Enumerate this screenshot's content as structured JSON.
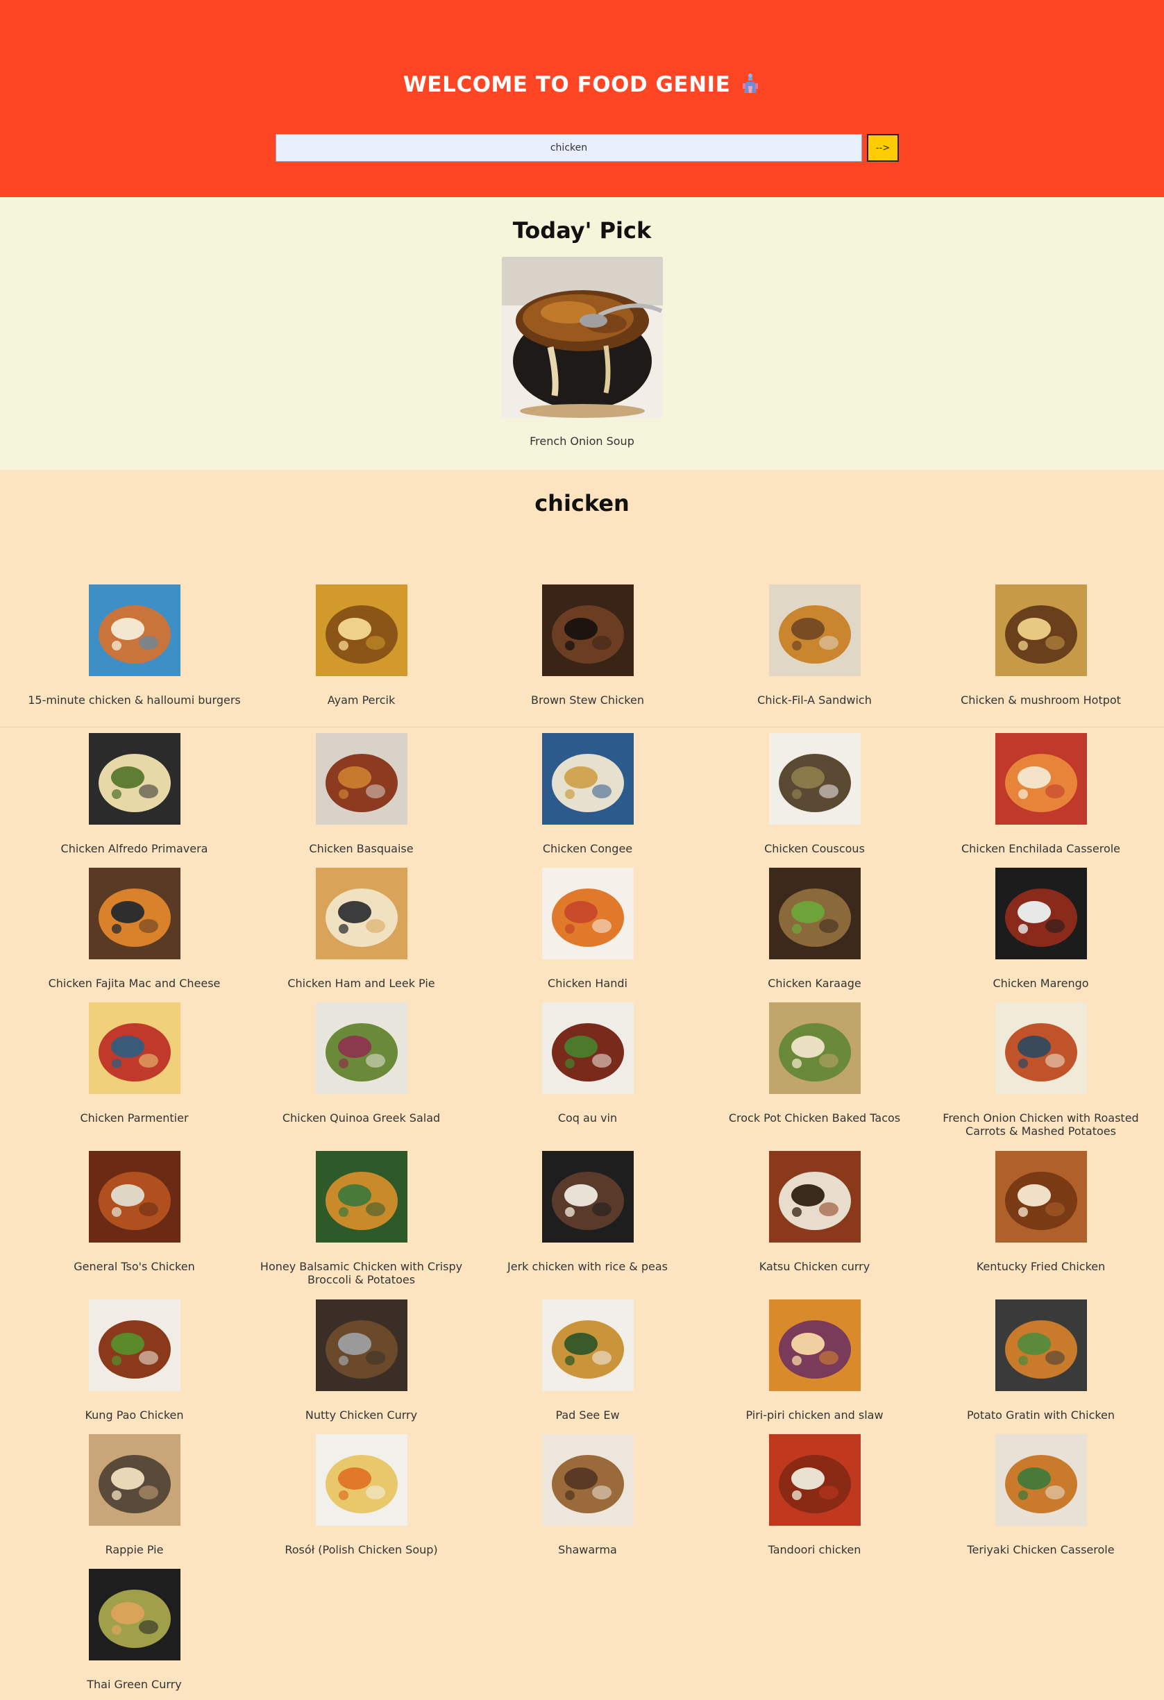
{
  "header": {
    "title": "WELCOME TO FOOD GENIE",
    "title_icon": "genie-icon",
    "background": "#fe4524"
  },
  "search": {
    "value": "chicken",
    "button_label": "-->"
  },
  "todays_pick": {
    "heading": "Today' Pick",
    "name": "French Onion Soup"
  },
  "results": {
    "heading": "chicken",
    "items": [
      {
        "name": "15-minute chicken & halloumi burgers",
        "palette": [
          "#3f8fc7",
          "#c8743a",
          "#f3e7cf"
        ]
      },
      {
        "name": "Ayam Percik",
        "palette": [
          "#d19a2b",
          "#8a5516",
          "#f0d18a"
        ]
      },
      {
        "name": "Brown Stew Chicken",
        "palette": [
          "#3a2416",
          "#6b3d22",
          "#1d1410"
        ]
      },
      {
        "name": "Chick-Fil-A Sandwich",
        "palette": [
          "#e0d7c6",
          "#c9862e",
          "#7a4c23"
        ]
      },
      {
        "name": "Chicken & mushroom Hotpot",
        "palette": [
          "#c79a48",
          "#6a3f1c",
          "#e8c982"
        ]
      },
      {
        "name": "Chicken Alfredo Primavera",
        "palette": [
          "#2b2b2b",
          "#e7d8a8",
          "#5f7d33"
        ]
      },
      {
        "name": "Chicken Basquaise",
        "palette": [
          "#d8d2c8",
          "#8c3a20",
          "#c77a2e"
        ]
      },
      {
        "name": "Chicken Congee",
        "palette": [
          "#2d5a8c",
          "#e6e0cf",
          "#d0a553"
        ]
      },
      {
        "name": "Chicken Couscous",
        "palette": [
          "#f2efe9",
          "#5b4a33",
          "#8a7a4a"
        ]
      },
      {
        "name": "Chicken Enchilada Casserole",
        "palette": [
          "#c0392b",
          "#e8833a",
          "#f3e3c8"
        ]
      },
      {
        "name": "Chicken Fajita Mac and Cheese",
        "palette": [
          "#5a3a22",
          "#d9822b",
          "#2e2e2e"
        ]
      },
      {
        "name": "Chicken Ham and Leek Pie",
        "palette": [
          "#d9a35a",
          "#f0e2c0",
          "#3c3c3c"
        ]
      },
      {
        "name": "Chicken Handi",
        "palette": [
          "#f5f0ea",
          "#e07a2a",
          "#c94b2a"
        ]
      },
      {
        "name": "Chicken Karaage",
        "palette": [
          "#3b2a1c",
          "#8a6a3a",
          "#6ea33a"
        ]
      },
      {
        "name": "Chicken Marengo",
        "palette": [
          "#1c1c1c",
          "#8a2a1a",
          "#e8e8e8"
        ]
      },
      {
        "name": "Chicken Parmentier",
        "palette": [
          "#f0d07a",
          "#c0392b",
          "#3a5a7a"
        ]
      },
      {
        "name": "Chicken Quinoa Greek Salad",
        "palette": [
          "#e8e6dc",
          "#6a8a3a",
          "#8a3a4a"
        ]
      },
      {
        "name": "Coq au vin",
        "palette": [
          "#f0ece6",
          "#7a2a1a",
          "#4a7a2a"
        ]
      },
      {
        "name": "Crock Pot Chicken Baked Tacos",
        "palette": [
          "#c0a66a",
          "#6a8a3a",
          "#e8e0c0"
        ]
      },
      {
        "name": "French Onion Chicken with Roasted Carrots & Mashed Potatoes",
        "palette": [
          "#f0ead8",
          "#c0532a",
          "#3a4a5a"
        ]
      },
      {
        "name": "General Tso's Chicken",
        "palette": [
          "#6a2a14",
          "#b0501e",
          "#e0d6c6"
        ]
      },
      {
        "name": "Honey Balsamic Chicken with Crispy Broccoli & Potatoes",
        "palette": [
          "#2e5a2a",
          "#c98a2a",
          "#4a7a3a"
        ]
      },
      {
        "name": "Jerk chicken with rice & peas",
        "palette": [
          "#1e1e1e",
          "#5a3a2a",
          "#e8e2d6"
        ]
      },
      {
        "name": "Katsu Chicken curry",
        "palette": [
          "#8a3a1a",
          "#e8dccc",
          "#3a2a1a"
        ]
      },
      {
        "name": "Kentucky Fried Chicken",
        "palette": [
          "#b0602a",
          "#7a3a14",
          "#f0e0c8"
        ]
      },
      {
        "name": "Kung Pao Chicken",
        "palette": [
          "#f2ece6",
          "#8a3a1a",
          "#5a8a2a"
        ]
      },
      {
        "name": "Nutty Chicken Curry",
        "palette": [
          "#3a2e26",
          "#6a4a2a",
          "#9a9a9a"
        ]
      },
      {
        "name": "Pad See Ew",
        "palette": [
          "#f2efea",
          "#c9943a",
          "#3a5a2a"
        ]
      },
      {
        "name": "Piri-piri chicken and slaw",
        "palette": [
          "#d98a2a",
          "#7a3a5a",
          "#f0d0a0"
        ]
      },
      {
        "name": "Potato Gratin with Chicken",
        "palette": [
          "#3a3a3a",
          "#c97a2a",
          "#5a8a3a"
        ]
      },
      {
        "name": "Rappie Pie",
        "palette": [
          "#c9a678",
          "#5a4a3a",
          "#e8d8b8"
        ]
      },
      {
        "name": "Rosół (Polish Chicken Soup)",
        "palette": [
          "#f2f0ea",
          "#e8c86a",
          "#e07a2a"
        ]
      },
      {
        "name": "Shawarma",
        "palette": [
          "#ece6dc",
          "#9a6a3a",
          "#5a3a24"
        ]
      },
      {
        "name": "Tandoori chicken",
        "palette": [
          "#c0391e",
          "#8a2a14",
          "#e8e0d0"
        ]
      },
      {
        "name": "Teriyaki Chicken Casserole",
        "palette": [
          "#e8e2d6",
          "#c97a2a",
          "#4a7a3a"
        ]
      },
      {
        "name": "Thai Green Curry",
        "palette": [
          "#1e1e1e",
          "#a0a04a",
          "#d9a35a"
        ]
      }
    ]
  }
}
